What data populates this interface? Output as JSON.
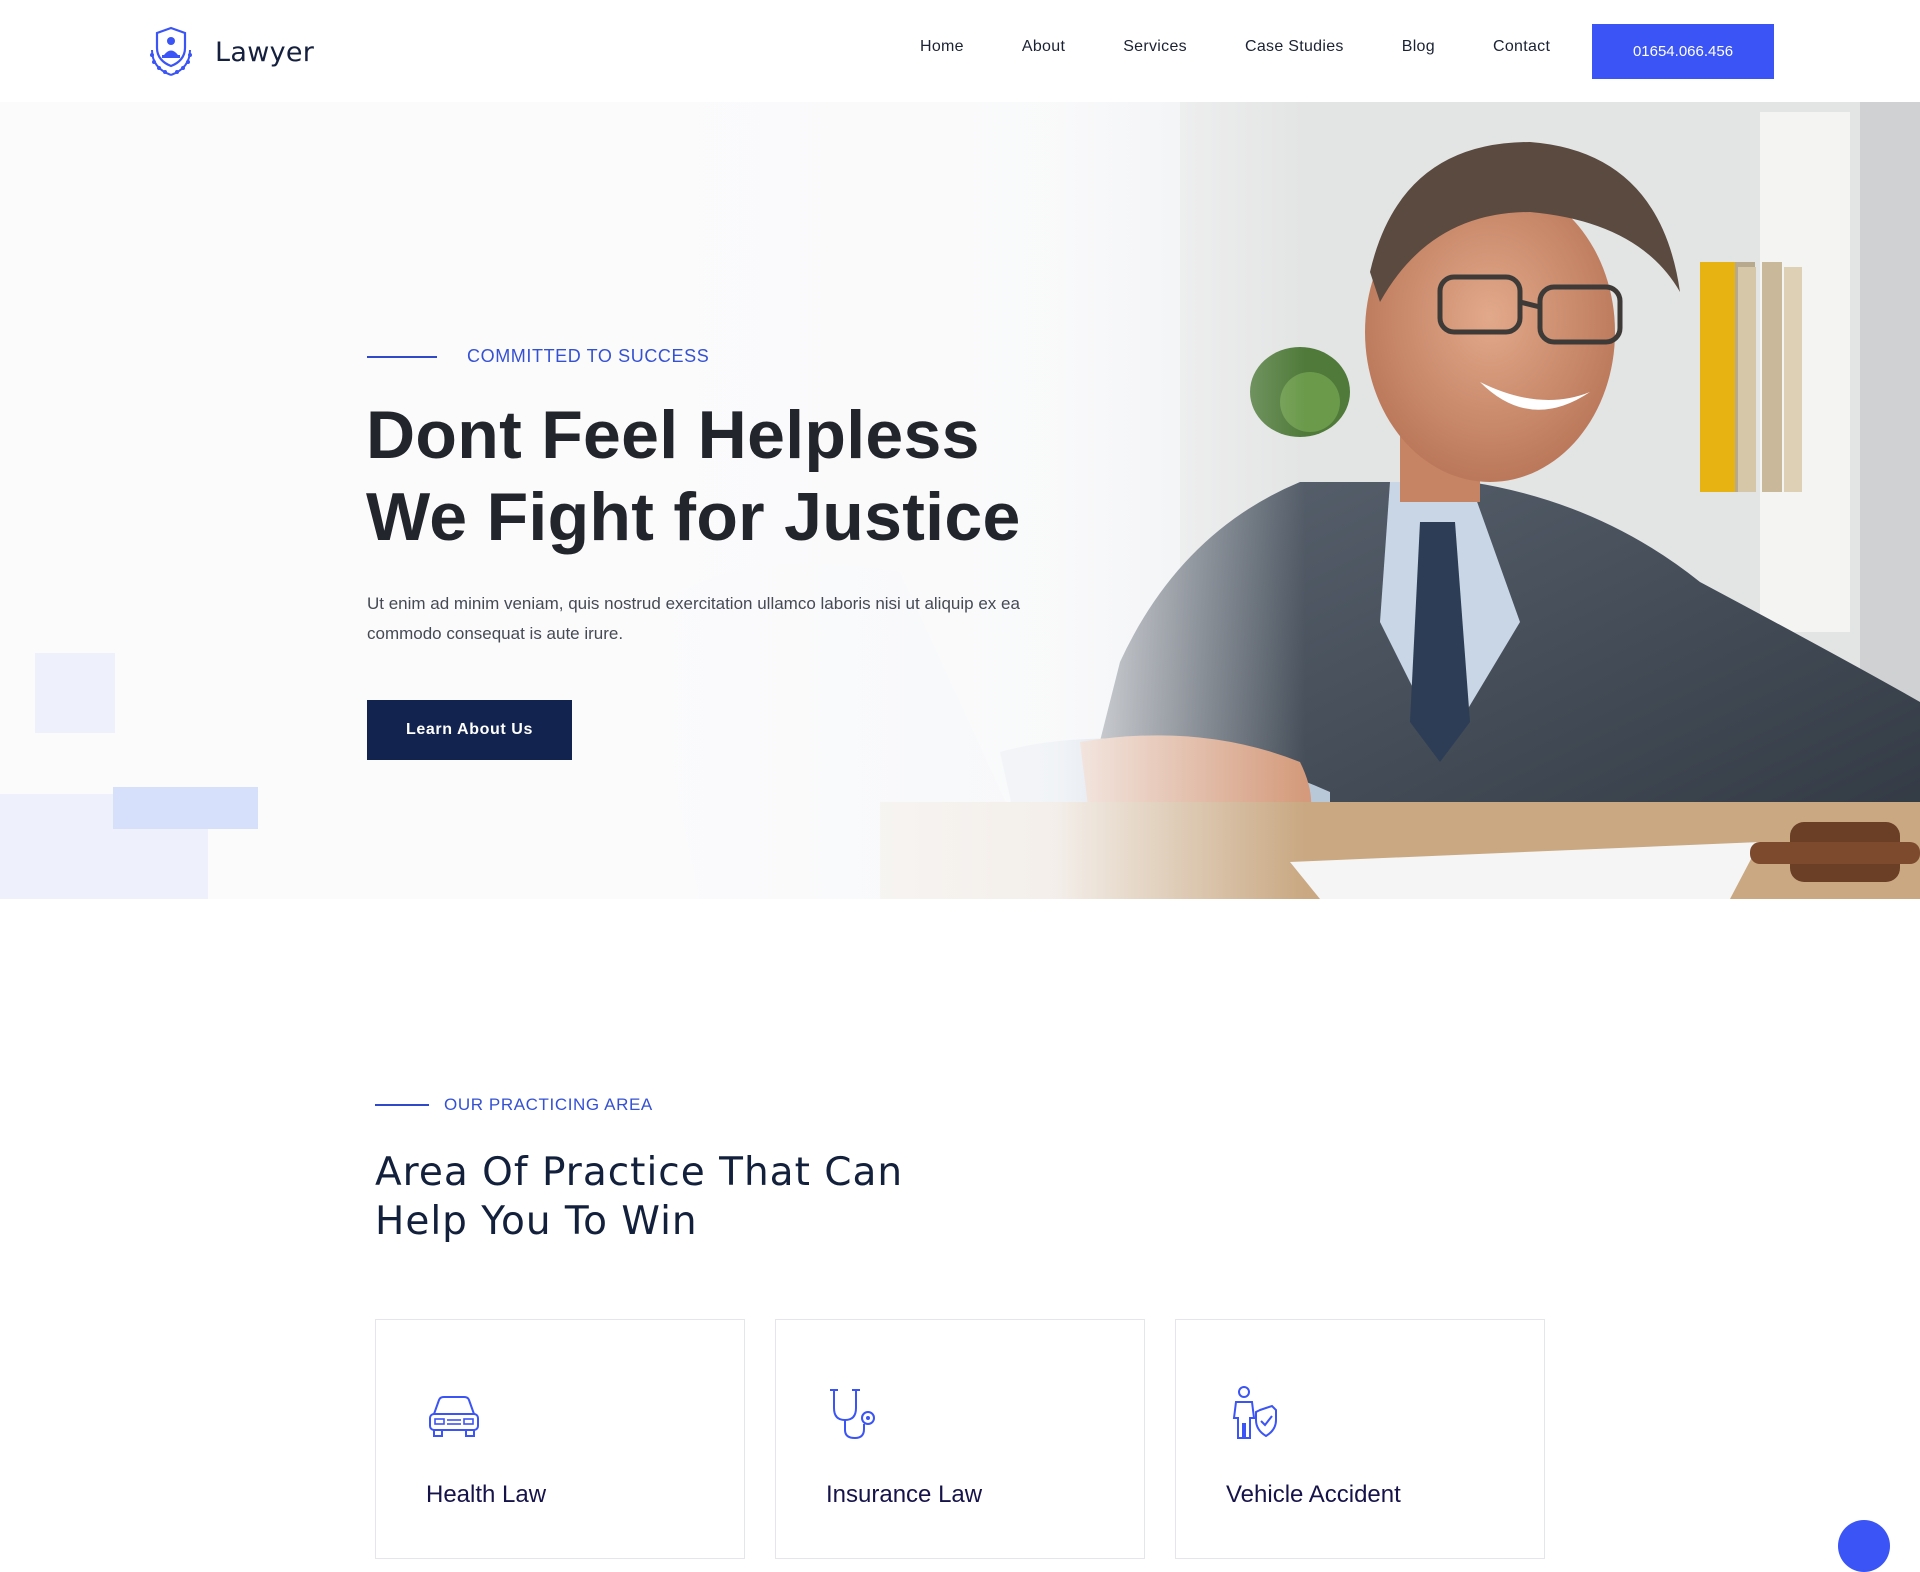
{
  "header": {
    "logo_text": "Lawyer",
    "logo_icon": "scales-emblem-icon",
    "nav": [
      {
        "label": "Home"
      },
      {
        "label": "About"
      },
      {
        "label": "Services"
      },
      {
        "label": "Case Studies"
      },
      {
        "label": "Blog"
      },
      {
        "label": "Contact"
      }
    ],
    "phone_label": "01654.066.456"
  },
  "hero": {
    "eyebrow": "COMMITTED TO SUCCESS",
    "title_line1": "Dont Feel Helpless",
    "title_line2": "We Fight for Justice",
    "description": "Ut enim ad minim veniam, quis nostrud exercitation ullamco laboris nisi ut aliquip ex ea commodo consequat is aute irure.",
    "button_label": "Learn About Us",
    "image": "lawyer-handshake-photo"
  },
  "practice": {
    "eyebrow": "OUR PRACTICING AREA",
    "title_line1": "Area Of Practice That Can",
    "title_line2": "Help You To Win",
    "cards": [
      {
        "title": "Health Law",
        "icon": "car-icon"
      },
      {
        "title": "Insurance Law",
        "icon": "stethoscope-icon"
      },
      {
        "title": "Vehicle Accident",
        "icon": "person-shield-icon"
      }
    ]
  },
  "colors": {
    "accent": "#3b54f5",
    "navy": "#13234f",
    "eyebrow": "#3551d3",
    "heading": "#13203c"
  }
}
